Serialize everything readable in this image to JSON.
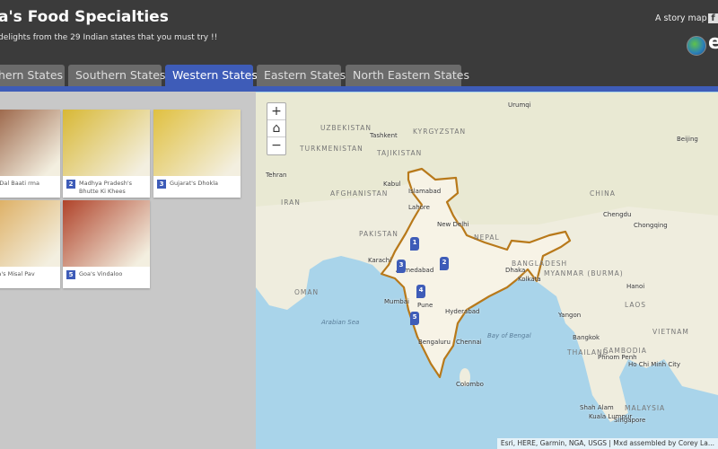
{
  "header": {
    "title": "a's Food Specialties",
    "subtitle": "delights from the 29 Indian states that you must try !!",
    "story_map": "A story map",
    "brand": "e",
    "facebook_icon": "f"
  },
  "tabs": [
    {
      "label": "hern States"
    },
    {
      "label": "Southern States"
    },
    {
      "label": "Western States",
      "active": true
    },
    {
      "label": "Eastern States"
    },
    {
      "label": "North Eastern States"
    }
  ],
  "accent": "#3e5cb8",
  "cards": [
    {
      "num": "",
      "caption": "sthan's Dal Baati rma",
      "color": "#8a4a2a"
    },
    {
      "num": "2",
      "caption": "Madhya Pradesh's Bhutte Ki Khees",
      "color": "#d8b835"
    },
    {
      "num": "3",
      "caption": "Gujarat's Dhokla",
      "color": "#e0c040"
    },
    {
      "num": "",
      "caption": "arashtra's Misal Pav",
      "color": "#d9a24a"
    },
    {
      "num": "5",
      "caption": "Goa's Vindaloo",
      "color": "#b0432a"
    }
  ],
  "map": {
    "zoom_in": "+",
    "zoom_out": "−",
    "home_icon": "⌂",
    "labels": [
      "Urumqi",
      "Tashkent",
      "Beijing",
      "Tehran",
      "Kabul",
      "Islamabad",
      "Lahore",
      "Chengdu",
      "Chongqing",
      "New Delhi",
      "Karachi",
      "Dhaka",
      "Ahmedabad",
      "Kolkata",
      "Hanoi",
      "Mumbai",
      "Pune",
      "Hyderabad",
      "Yangon",
      "Bengaluru",
      "Chennai",
      "Bangkok",
      "Phnom Penh",
      "Ho Chi Minh City",
      "Colombo",
      "Shah Alam",
      "Kuala Lumpur",
      "Singapore"
    ],
    "countries": [
      "UZBEKISTAN",
      "KYRGYZSTAN",
      "TAJIKISTAN",
      "TURKMENISTAN",
      "AFGHANISTAN",
      "CHINA",
      "IRAN",
      "PAKISTAN",
      "NEPAL",
      "BANGLADESH",
      "MYANMAR (BURMA)",
      "OMAN",
      "LAOS",
      "VIETNAM",
      "THAILAND",
      "CAMBODIA",
      "MALAYSIA"
    ],
    "seas": [
      "Arabian Sea",
      "Bay of Bengal"
    ],
    "markers": [
      "1",
      "2",
      "3",
      "4",
      "5"
    ],
    "attribution": "Esri, HERE, Garmin, NGA, USGS | Mxd assembled by Corey La..."
  }
}
